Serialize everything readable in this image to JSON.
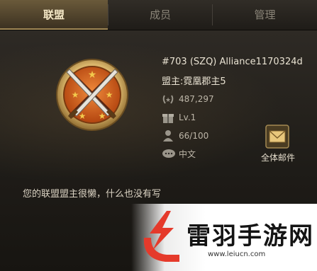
{
  "tabs": [
    {
      "label": "联盟",
      "active": true
    },
    {
      "label": "成员",
      "active": false
    },
    {
      "label": "管理",
      "active": false
    }
  ],
  "alliance": {
    "name_line": "#703 (SZQ) Alliance1170324d",
    "leader_line": "盟主:霓凰郡主5",
    "power": "487,297",
    "level": "Lv.1",
    "members": "66/100",
    "language": "中文",
    "emblem_icon": "crossed-swords-shield-icon"
  },
  "mail_button": {
    "label": "全体邮件",
    "icon": "envelope-icon"
  },
  "description": "您的联盟盟主很懒，什么也没有写",
  "watermark": {
    "title": "雷羽手游网",
    "url": "www.leiucn.com",
    "logo_color": "#e53a2b"
  },
  "colors": {
    "active_tab": "#6a5a3a",
    "gold_text": "#f4e7c6",
    "emblem_orange": "#d8621e",
    "star_gold": "#f2c94c"
  }
}
